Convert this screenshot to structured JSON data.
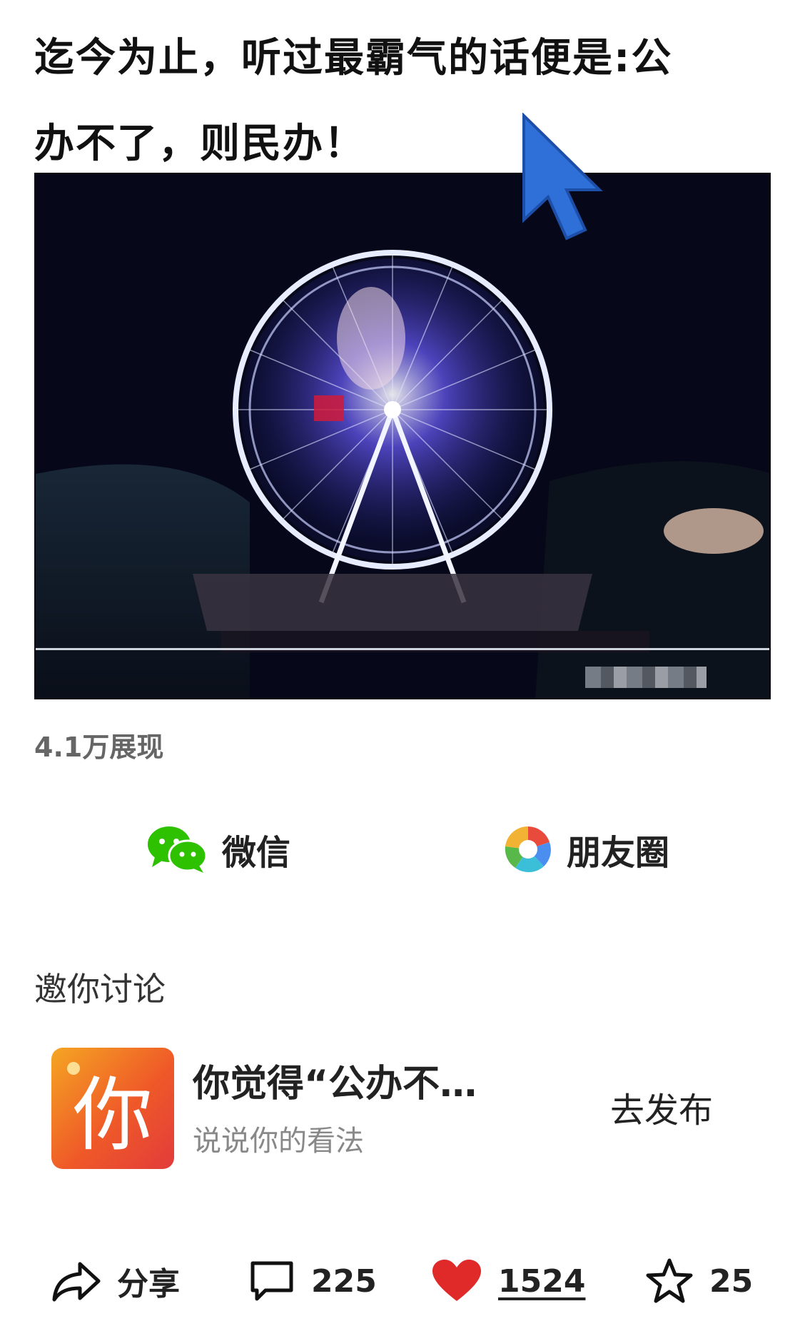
{
  "post": {
    "title_line1": "迄今为止，听过最霸气的话便是:公",
    "title_line2": "办不了，则民办！"
  },
  "stats": {
    "views": "4.1万展现"
  },
  "share": {
    "wechat_label": "微信",
    "moments_label": "朋友圈"
  },
  "discussion": {
    "section_title": "邀你讨论",
    "badge_char": "你",
    "question": "你觉得“公办不…",
    "subtitle": "说说你的看法",
    "publish_label": "去发布"
  },
  "actions": {
    "share_label": "分享",
    "comments": "225",
    "likes": "1524",
    "favorites": "25"
  },
  "colors": {
    "cursor_blue": "#2f6fd8",
    "heart_red": "#e02a2a",
    "wechat_green": "#2dc100",
    "badge_orange": "#ef5a28"
  },
  "icons": [
    "cursor-icon",
    "wechat-icon",
    "moments-icon",
    "share-arrow-icon",
    "comment-icon",
    "heart-icon",
    "star-icon"
  ]
}
